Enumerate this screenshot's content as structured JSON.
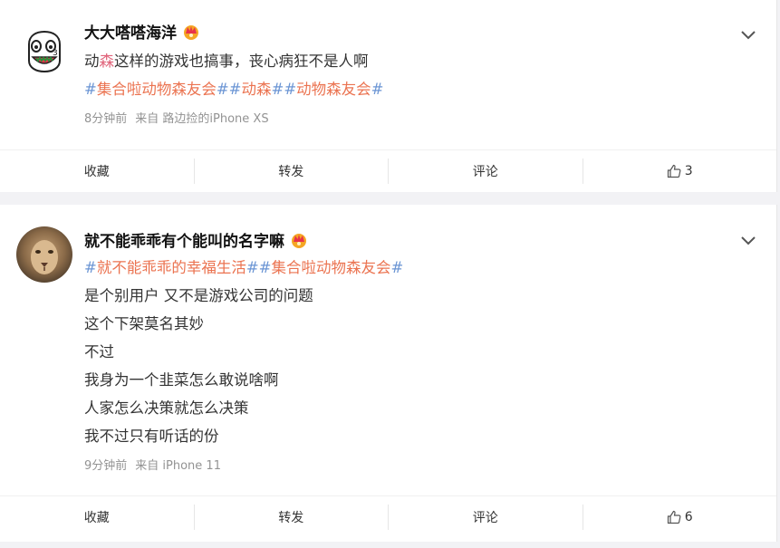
{
  "posts": [
    {
      "user": "大大嗒嗒海洋",
      "text_parts": [
        "动",
        "森",
        "这样的游戏也搞事，丧心病狂不是人啊"
      ],
      "tags": [
        {
          "hash_open": "#",
          "label": "集合啦动物森友会",
          "hash_close": "#"
        },
        {
          "hash_open": "#",
          "label": "动森",
          "hash_close": "#"
        },
        {
          "hash_open": "#",
          "label": "动物森友会",
          "hash_close": "#"
        }
      ],
      "time": "8分钟前",
      "source": "来自 路边捡的iPhone XS",
      "actions": {
        "collect": "收藏",
        "repost": "转发",
        "comment": "评论",
        "likes": "3"
      }
    },
    {
      "user": "就不能乖乖有个能叫的名字嘛",
      "tags": [
        {
          "hash_open": "#",
          "label": "就不能乖乖的幸福生活",
          "hash_close": "#"
        },
        {
          "hash_open": "#",
          "label": "集合啦动物森友会",
          "hash_close": "#"
        }
      ],
      "lines": [
        "是个别用户 又不是游戏公司的问题",
        "这个下架莫名其妙",
        "不过",
        "我身为一个韭菜怎么敢说啥啊",
        "人家怎么决策就怎么决策",
        "我不过只有听话的份"
      ],
      "time": "9分钟前",
      "source": "来自 iPhone 11",
      "actions": {
        "collect": "收藏",
        "repost": "转发",
        "comment": "评论",
        "likes": "6"
      }
    }
  ],
  "icons": {
    "crown": "crown-icon",
    "chevron": "chevron-down-icon",
    "like": "thumbs-up-icon"
  },
  "colors": {
    "tag_text": "#eb7350",
    "tag_hash": "#6b95d4",
    "highlight": "#e0637a",
    "meta": "#939393"
  }
}
